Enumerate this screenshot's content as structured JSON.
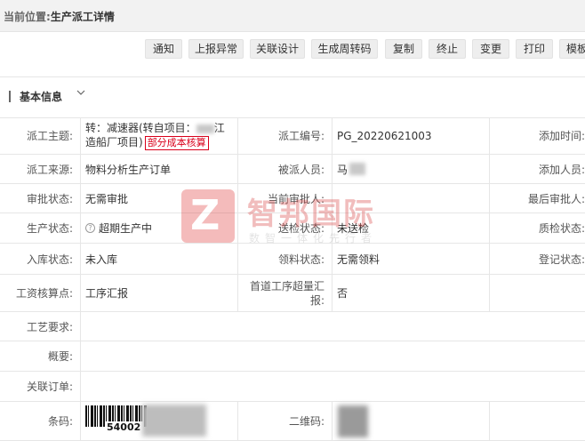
{
  "breadcrumb": {
    "prefix": "当前位置:",
    "current": "生产派工详情"
  },
  "toolbar": {
    "buttons": [
      "通知",
      "上报异常",
      "关联设计",
      "生成周转码",
      "复制",
      "终止",
      "变更",
      "打印",
      "模板"
    ]
  },
  "section": {
    "title": "基本信息",
    "chevron": "chevron-down-icon"
  },
  "fields": {
    "subject_label": "派工主题:",
    "subject_value_line1": "转：减速器(转自项目：",
    "subject_value_mid": "江",
    "subject_value_line2": "造船厂项目)",
    "subject_tag": "部分成本核算",
    "code_label": "派工编号:",
    "code_value": "PG_20220621003",
    "add_time_label": "添加时间:",
    "source_label": "派工来源:",
    "source_value": "物料分析生产订单",
    "assignee_label": "被派人员:",
    "assignee_value": "马",
    "adder_label": "添加人员:",
    "approval_label": "审批状态:",
    "approval_value": "无需审批",
    "current_approver_label": "当前审批人:",
    "last_approver_label": "最后审批人:",
    "production_label": "生产状态:",
    "production_value": "超期生产中",
    "inspection_send_label": "送检状态:",
    "inspection_send_value": "未送检",
    "quality_label": "质检状态:",
    "warehouse_label": "入库状态:",
    "warehouse_value": "未入库",
    "material_label": "领料状态:",
    "material_value": "无需领料",
    "register_label": "登记状态:",
    "wage_label": "工资核算点:",
    "wage_value": "工序汇报",
    "first_proc_label": "首道工序超量汇报:",
    "first_proc_value": "否",
    "craft_label": "工艺要求:",
    "summary_label": "概要:",
    "related_order_label": "关联订单:",
    "barcode_label": "条码:",
    "barcode_number": "54002",
    "qrcode_label": "二维码:"
  },
  "watermark": {
    "name": "智邦国际",
    "slogan": "数智一体化先行者",
    "logo_letter": "Z"
  }
}
